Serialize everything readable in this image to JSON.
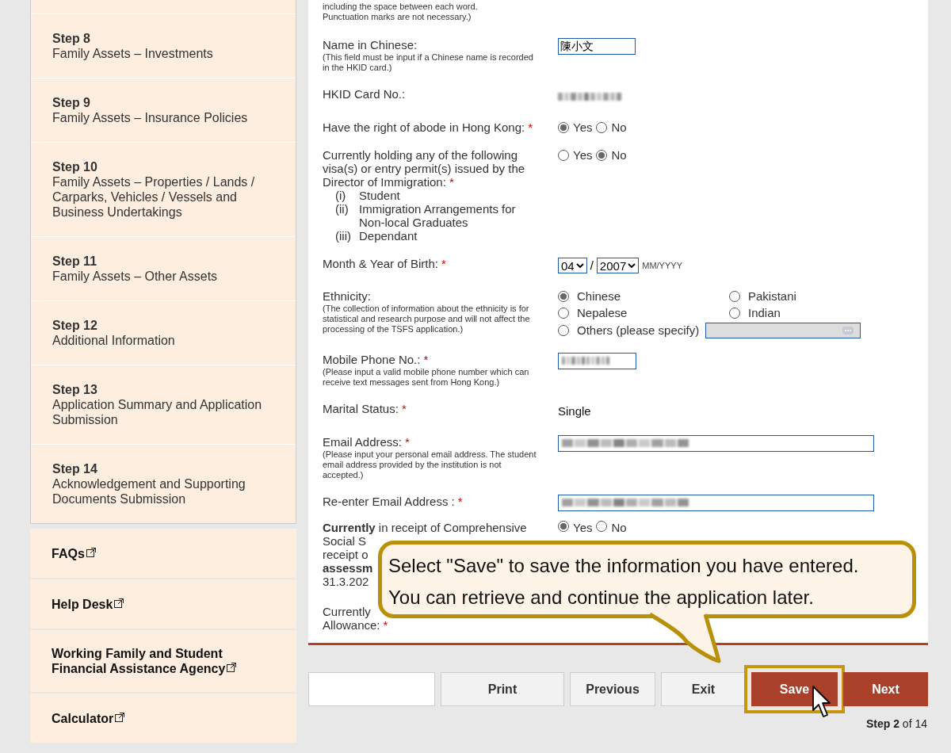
{
  "sidebar": {
    "steps": [
      {
        "step": "Step 8",
        "title": "Family Assets – Investments"
      },
      {
        "step": "Step 9",
        "title": "Family Assets – Insurance Policies"
      },
      {
        "step": "Step 10",
        "title": "Family Assets – Properties / Lands / Carparks, Vehicles / Vessels and Business Undertakings"
      },
      {
        "step": "Step 11",
        "title": "Family Assets – Other Assets"
      },
      {
        "step": "Step 12",
        "title": "Additional Information"
      },
      {
        "step": "Step 13",
        "title": "Application Summary and Application Submission"
      },
      {
        "step": "Step 14",
        "title": "Acknowledgement and Supporting Documents Submission"
      }
    ],
    "links": [
      "FAQs",
      "Help Desk",
      "Working Family and Student Financial Assistance Agency",
      "Calculator"
    ]
  },
  "form": {
    "top_note": [
      "including the space between each word.",
      "Punctuation marks are not necessary.)"
    ],
    "rows": [
      {
        "kind": "text",
        "label": "Name in Chinese:",
        "note": "(This field must be input if a Chinese name is recorded in the HKID card.)",
        "value": "陳小文"
      },
      {
        "kind": "blurred",
        "label": "HKID Card No.:"
      },
      {
        "kind": "radio",
        "label": "Have the right of abode in Hong Kong:",
        "mark": "*",
        "options": [
          {
            "label": "Yes",
            "selected": true
          },
          {
            "label": "No",
            "selected": false
          }
        ]
      },
      {
        "kind": "radio",
        "label": "Currently holding any of the following visa(s) or entry permit(s) issued by the Director of Immigration:",
        "mark": "*",
        "list": [
          {
            "num": "(i)",
            "text": "Student"
          },
          {
            "num": "(ii)",
            "text": "Immigration Arrangements for Non-local Graduates"
          },
          {
            "num": "(iii)",
            "text": "Dependant"
          }
        ],
        "options": [
          {
            "label": "Yes",
            "selected": false
          },
          {
            "label": "No",
            "selected": true
          }
        ]
      },
      {
        "kind": "date",
        "label": "Month & Year of Birth:",
        "mark": "*",
        "month": "04",
        "separator": "/",
        "year": "2007",
        "hint": "MM/YYYY"
      },
      {
        "kind": "ethnicity",
        "label": "Ethnicity:",
        "note": "(The collection of information about the ethnicity is for statistical and research purpose and will not affect the processing of the TSFS application.)",
        "options": [
          {
            "label": "Chinese",
            "selected": true
          },
          {
            "label": "Pakistani",
            "selected": false
          },
          {
            "label": "Nepalese",
            "selected": false
          },
          {
            "label": "Indian",
            "selected": false
          },
          {
            "label": "Others (please specify)",
            "selected": false
          }
        ]
      },
      {
        "kind": "blurred-field",
        "label": "Mobile Phone No.:",
        "mark": "*",
        "note": "(Please input a valid mobile phone number which can receive text messages sent from Hong Kong.)"
      },
      {
        "kind": "plain",
        "label": "Marital Status:",
        "mark": "*",
        "value": "Single"
      },
      {
        "kind": "blurred-wide",
        "label": "Email Address:",
        "mark": "*",
        "note": "(Please input your personal email address. The student email address provided by the institution is not accepted.)"
      },
      {
        "kind": "blurred-wide",
        "label": "Re-enter Email Address :",
        "mark": "*"
      }
    ],
    "covered": {
      "lines": [
        {
          "text": "**Currently** in receipt of Comprehensive",
          "bold": false
        },
        {
          "text": "Social S",
          "bold": false
        },
        {
          "text": "receipt o",
          "bold": false
        },
        {
          "text": "assessm",
          "bold": true
        },
        {
          "text": "31.3.202",
          "bold": false
        }
      ],
      "options": [
        {
          "label": "Yes",
          "selected": true
        },
        {
          "label": "No",
          "selected": false
        }
      ],
      "last_lines": [
        {
          "text": "Currently"
        },
        {
          "text": "Allowance:",
          "mark": "*"
        }
      ]
    }
  },
  "buttons": [
    {
      "label": "Print",
      "kind": "plain",
      "highlighted": false
    },
    {
      "label": "Previous",
      "kind": "plain",
      "highlighted": false
    },
    {
      "label": "Exit",
      "kind": "plain",
      "highlighted": false
    },
    {
      "label": "Save",
      "kind": "primary",
      "highlighted": true
    },
    {
      "label": "Next",
      "kind": "primary",
      "highlighted": false
    }
  ],
  "step_indicator": {
    "prefix": "Step",
    "current": "2",
    "suffix": "of 14"
  },
  "callout": [
    "Select \"Save\" to save the information you have entered.",
    "You can retrieve and continue the application later."
  ]
}
